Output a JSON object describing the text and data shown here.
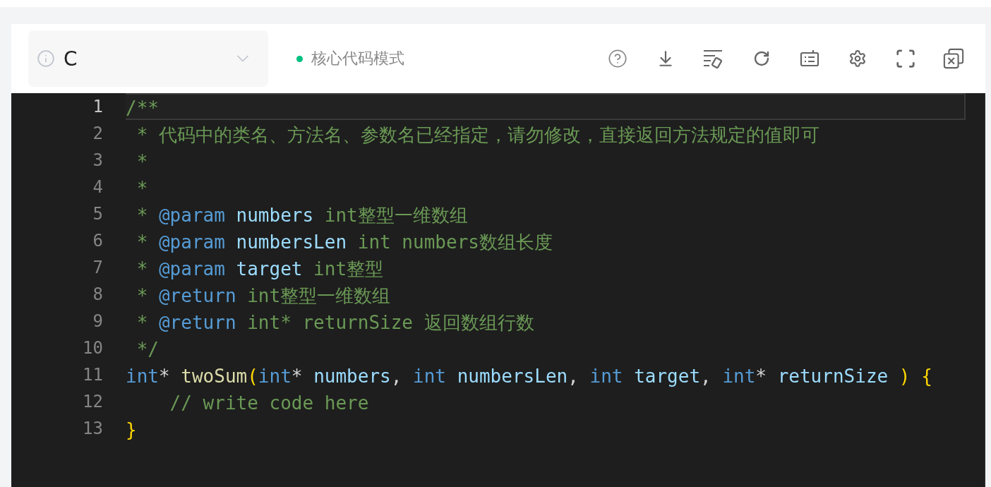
{
  "toolbar": {
    "language": "C",
    "mode": "核心代码模式"
  },
  "editor": {
    "lines": [
      {
        "number": "1",
        "selected": true,
        "tokens": [
          {
            "kind": "comment",
            "text": "/**"
          }
        ]
      },
      {
        "number": "2",
        "selected": false,
        "tokens": [
          {
            "kind": "comment",
            "text": " * 代码中的类名、方法名、参数名已经指定，请勿修改，直接返回方法规定的值即可"
          }
        ]
      },
      {
        "number": "3",
        "selected": false,
        "tokens": [
          {
            "kind": "comment",
            "text": " *"
          }
        ]
      },
      {
        "number": "4",
        "selected": false,
        "tokens": [
          {
            "kind": "comment",
            "text": " *"
          }
        ]
      },
      {
        "number": "5",
        "selected": false,
        "tokens": [
          {
            "kind": "comment",
            "text": " * "
          },
          {
            "kind": "tag",
            "text": "@param "
          },
          {
            "kind": "param",
            "text": "numbers"
          },
          {
            "kind": "comment",
            "text": " int整型一维数组"
          }
        ]
      },
      {
        "number": "6",
        "selected": false,
        "tokens": [
          {
            "kind": "comment",
            "text": " * "
          },
          {
            "kind": "tag",
            "text": "@param "
          },
          {
            "kind": "param",
            "text": "numbersLen"
          },
          {
            "kind": "comment",
            "text": " int numbers数组长度"
          }
        ]
      },
      {
        "number": "7",
        "selected": false,
        "tokens": [
          {
            "kind": "comment",
            "text": " * "
          },
          {
            "kind": "tag",
            "text": "@param "
          },
          {
            "kind": "param",
            "text": "target"
          },
          {
            "kind": "comment",
            "text": " int整型"
          }
        ]
      },
      {
        "number": "8",
        "selected": false,
        "tokens": [
          {
            "kind": "comment",
            "text": " * "
          },
          {
            "kind": "tag",
            "text": "@return"
          },
          {
            "kind": "comment",
            "text": " int整型一维数组"
          }
        ]
      },
      {
        "number": "9",
        "selected": false,
        "tokens": [
          {
            "kind": "comment",
            "text": " * "
          },
          {
            "kind": "tag",
            "text": "@return"
          },
          {
            "kind": "comment",
            "text": " int* returnSize 返回数组行数"
          }
        ]
      },
      {
        "number": "10",
        "selected": false,
        "tokens": [
          {
            "kind": "comment",
            "text": " */"
          }
        ]
      },
      {
        "number": "11",
        "selected": false,
        "tokens": [
          {
            "kind": "keyword",
            "text": "int"
          },
          {
            "kind": "plain",
            "text": "* "
          },
          {
            "kind": "func",
            "text": "twoSum"
          },
          {
            "kind": "bracket",
            "text": "("
          },
          {
            "kind": "keyword",
            "text": "int"
          },
          {
            "kind": "plain",
            "text": "* "
          },
          {
            "kind": "param",
            "text": "numbers"
          },
          {
            "kind": "plain",
            "text": ", "
          },
          {
            "kind": "keyword",
            "text": "int "
          },
          {
            "kind": "param",
            "text": "numbersLen"
          },
          {
            "kind": "plain",
            "text": ", "
          },
          {
            "kind": "keyword",
            "text": "int "
          },
          {
            "kind": "param",
            "text": "target"
          },
          {
            "kind": "plain",
            "text": ", "
          },
          {
            "kind": "keyword",
            "text": "int"
          },
          {
            "kind": "plain",
            "text": "* "
          },
          {
            "kind": "param",
            "text": "returnSize "
          },
          {
            "kind": "bracket",
            "text": ") {"
          }
        ]
      },
      {
        "number": "12",
        "selected": false,
        "tokens": [
          {
            "kind": "comment",
            "text": "    // write code here"
          }
        ]
      },
      {
        "number": "13",
        "selected": false,
        "tokens": [
          {
            "kind": "bracket",
            "text": "}"
          }
        ]
      }
    ]
  }
}
